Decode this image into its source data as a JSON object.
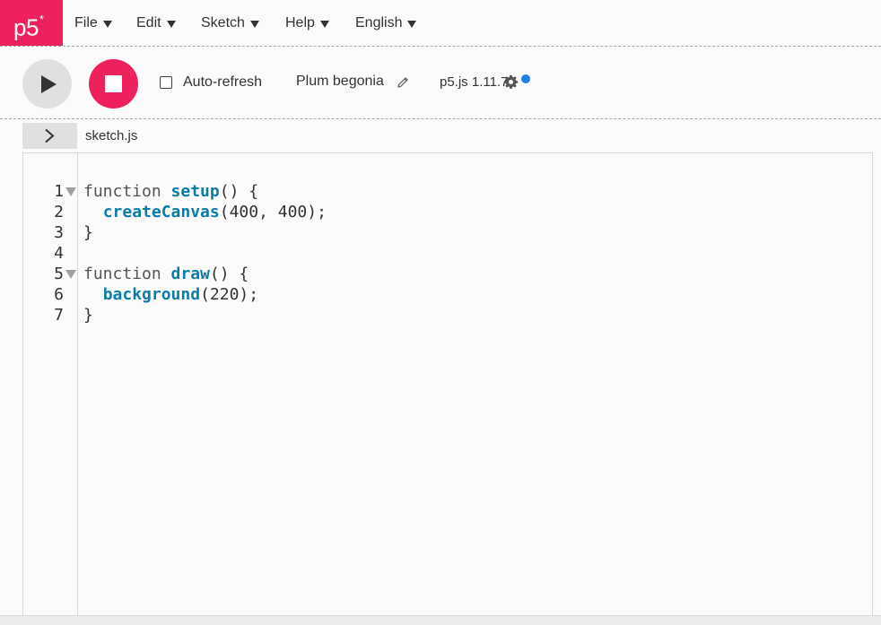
{
  "app": {
    "logo_text": "p5",
    "logo_mark": "*",
    "accent_color": "#ed225d",
    "notice_dot_color": "#1f7df2"
  },
  "menu": {
    "items": [
      {
        "label": "File"
      },
      {
        "label": "Edit"
      },
      {
        "label": "Sketch"
      },
      {
        "label": "Help"
      },
      {
        "label": "English"
      }
    ]
  },
  "toolbar": {
    "play_icon": "play-icon",
    "stop_icon": "stop-icon",
    "auto_refresh_label": "Auto-refresh",
    "auto_refresh_checked": false,
    "sketch_name": "Plum begonia",
    "edit_icon": "pencil-icon",
    "version_label": "p5.js 1.11.7",
    "settings_icon": "gear-icon"
  },
  "files": {
    "expand_icon": "chevron-right-icon",
    "active_file": "sketch.js"
  },
  "editor": {
    "lines": [
      {
        "num": "1",
        "text": "function setup() {"
      },
      {
        "num": "2",
        "text": "  createCanvas(400, 400);"
      },
      {
        "num": "3",
        "text": "}"
      },
      {
        "num": "4",
        "text": ""
      },
      {
        "num": "5",
        "text": "function draw() {"
      },
      {
        "num": "6",
        "text": "  background(220);"
      },
      {
        "num": "7",
        "text": "}"
      }
    ]
  }
}
